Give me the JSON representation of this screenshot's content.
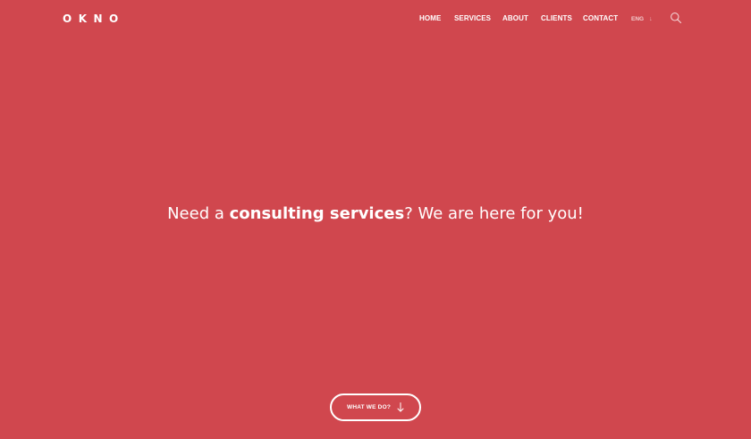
{
  "brand": {
    "logo": "OKNO"
  },
  "nav": {
    "items": [
      {
        "label": "HOME"
      },
      {
        "label": "SERVICES"
      },
      {
        "label": "ABOUT"
      },
      {
        "label": "CLIENTS"
      },
      {
        "label": "CONTACT"
      }
    ],
    "language": "ENG",
    "language_icon": "arrow-down-icon",
    "search_icon": "search-icon"
  },
  "hero": {
    "text_before": "Need a ",
    "text_bold": "consulting services",
    "text_after": "? We are here for you!",
    "cta_label": "WHAT WE DO?",
    "cta_icon": "arrow-down-icon"
  },
  "colors": {
    "background": "#d0474e",
    "text": "#ffffff"
  }
}
